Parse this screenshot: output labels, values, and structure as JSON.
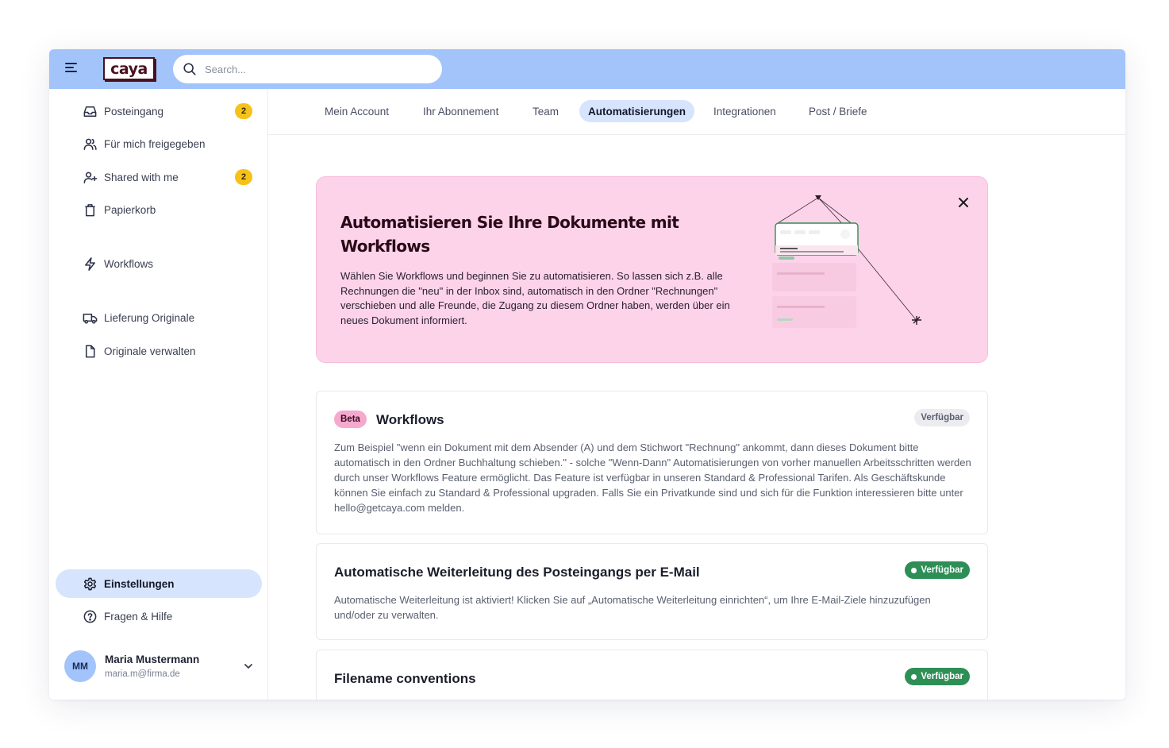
{
  "app": {
    "logo_text": "caya"
  },
  "search": {
    "placeholder": "Search..."
  },
  "sidebar": {
    "items": [
      {
        "label": "Posteingang",
        "badge": "2"
      },
      {
        "label": "Für mich freigegeben"
      },
      {
        "label": "Shared with me",
        "badge": "2"
      },
      {
        "label": "Papierkorb"
      },
      {
        "label": "Workflows"
      },
      {
        "label": "Lieferung Originale"
      },
      {
        "label": "Originale verwalten"
      }
    ],
    "bottom_items": [
      {
        "label": "Einstellungen",
        "active": true
      },
      {
        "label": "Fragen & Hilfe"
      }
    ],
    "user": {
      "initials": "MM",
      "name": "Maria Mustermann",
      "email": "maria.m@firma.de"
    }
  },
  "tabs": [
    {
      "label": "Mein Account"
    },
    {
      "label": "Ihr Abonnement"
    },
    {
      "label": "Team"
    },
    {
      "label": "Automatisierungen",
      "active": true
    },
    {
      "label": "Integrationen"
    },
    {
      "label": "Post / Briefe"
    }
  ],
  "hero": {
    "title": "Automatisieren Sie Ihre Dokumente mit Workflows",
    "text": "Wählen Sie Workflows und beginnen Sie zu automatisieren. So lassen sich z.B. alle Rechnungen die \"neu\" in der Inbox sind, automatisch in den Ordner \"Rechnungen\" verschieben und alle Freunde, die Zugang zu diesem Ordner haben, werden über ein neues Dokument informiert."
  },
  "cards": [
    {
      "badge": "Beta",
      "title": "Workflows",
      "status": "Verfügbar",
      "status_style": "grey",
      "description": "Zum Beispiel \"wenn ein Dokument mit dem Absender (A) und dem Stichwort \"Rechnung\" ankommt, dann dieses Dokument bitte automatisch in den Ordner Buchhaltung schieben.\" - solche \"Wenn-Dann\" Automatisierungen von vorher manuellen Arbeitsschritten werden durch unser Workflows Feature ermöglicht. Das Feature ist verfügbar in unseren Standard & Professional Tarifen. Als Geschäftskunde können Sie einfach zu Standard & Professional upgraden. Falls Sie ein Privatkunde sind und sich für die Funktion interessieren bitte unter hello@getcaya.com melden."
    },
    {
      "title": "Automatische Weiterleitung des Posteingangs per E-Mail",
      "status": "Verfügbar",
      "status_style": "green",
      "description": "Automatische Weiterleitung ist aktiviert! Klicken Sie auf „Automatische Weiterleitung einrichten“, um Ihre E-Mail-Ziele hinzuzufügen und/oder zu verwalten."
    },
    {
      "title": "Filename conventions",
      "status": "Verfügbar",
      "status_style": "green"
    }
  ],
  "colors": {
    "topbar": "#a2c4fb",
    "active_nav": "#d6e4fd",
    "badge_yellow": "#f6c21a",
    "hero_pink": "#fdd3ea",
    "beta_pink": "#f6a9cf",
    "status_green": "#2e8f56"
  }
}
